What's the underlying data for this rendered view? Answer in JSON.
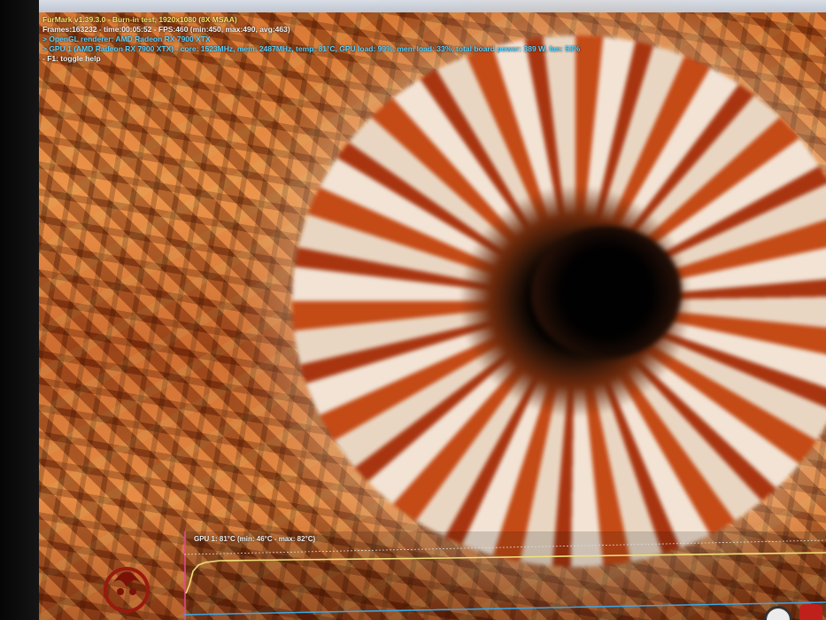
{
  "titlebar": {
    "text": ""
  },
  "overlay": {
    "line1": "FurMark v1.39.3.0 - Burn-in test, 1920x1080 (8X MSAA)",
    "line2": "Frames:163232 - time:00:05:52 - FPS:460 (min:450, max:490, avg:463)",
    "line3": "> OpenGL renderer: AMD Radeon RX 7900 XTX",
    "line4": "> GPU 1 (AMD Radeon RX 7900 XTX) - core: 1523MHz, mem: 2487MHz, temp: 81°C, GPU load: 99%, mem load: 33%, total board power: 389 W, fan: 53%",
    "line5": "- F1: toggle help"
  },
  "graph": {
    "label": "GPU 1: 81°C (min: 46°C - max: 82°C)"
  },
  "colors": {
    "title": "#f4e86a",
    "info": "#f2f2f2",
    "highlight": "#59d2ff",
    "graph_line": "#f0e07a"
  },
  "icons": [
    "furmark-logo-icon",
    "taskbar-app-icon",
    "taskbar-furmark-icon"
  ]
}
